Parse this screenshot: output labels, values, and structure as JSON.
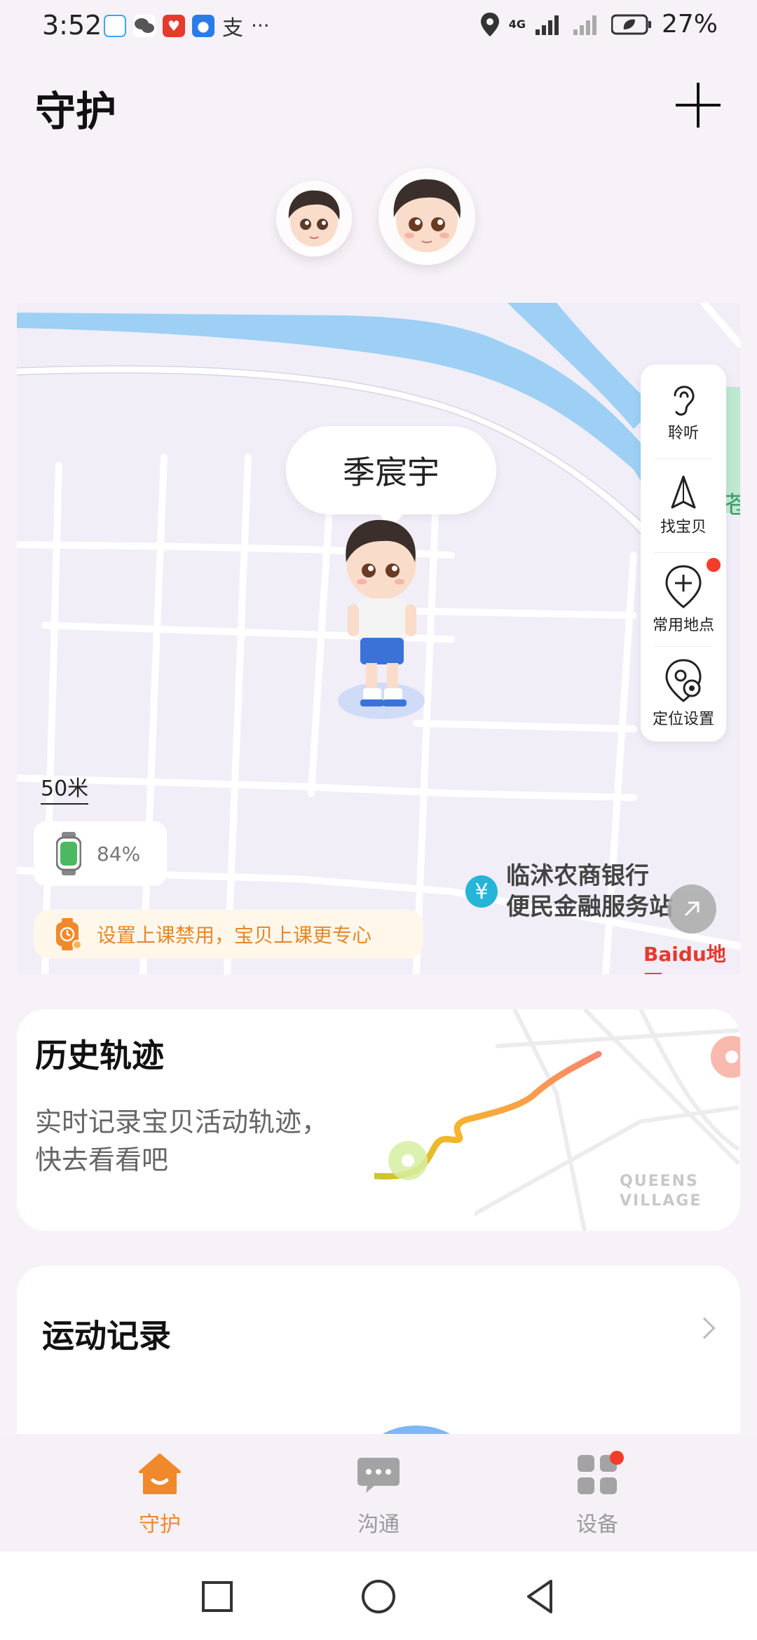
{
  "status_bar": {
    "time": "3:52",
    "app_glyph": "支",
    "more": "···",
    "network": "4G",
    "battery": "27%"
  },
  "header": {
    "title": "守护"
  },
  "map": {
    "child_name": "季宸宇",
    "scale": "50米",
    "watch_battery": "84%",
    "side_actions": [
      {
        "label": "聆听",
        "icon": "ear-icon"
      },
      {
        "label": "找宝贝",
        "icon": "navigation-arrow-icon"
      },
      {
        "label": "常用地点",
        "icon": "add-location-icon"
      },
      {
        "label": "定位设置",
        "icon": "location-settings-icon"
      }
    ],
    "poi_line1": "临沭农商银行",
    "poi_line2": "便民金融服务站",
    "poi_icon_glyph": "¥",
    "class_mode_tip": "设置上课禁用，宝贝上课更专心",
    "map_provider": "Baidu地图",
    "accent_color": "#f0892b"
  },
  "history": {
    "title": "历史轨迹",
    "description": "实时记录宝贝活动轨迹，快去看看吧",
    "map_label_line1": "QUEENS",
    "map_label_line2": "VILLAGE"
  },
  "sport": {
    "title": "运动记录"
  },
  "bottom_nav": [
    {
      "label": "守护",
      "active": true,
      "icon": "home-icon"
    },
    {
      "label": "沟通",
      "active": false,
      "icon": "chat-icon"
    },
    {
      "label": "设备",
      "active": false,
      "icon": "device-grid-icon"
    }
  ],
  "colors": {
    "active": "#f0892b",
    "inactive": "#9a9a9a",
    "badge": "#f33d2a"
  }
}
